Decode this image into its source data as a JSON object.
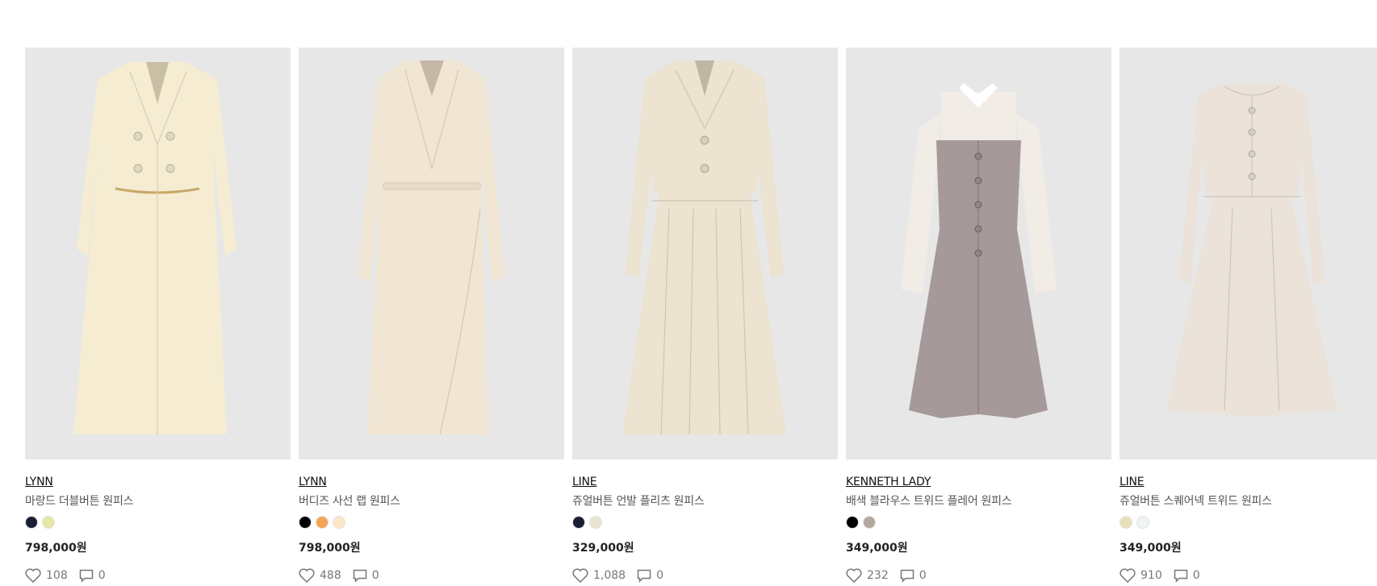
{
  "products": [
    {
      "brand": "LYNN",
      "name": "마랑드 더블버튼 원피스",
      "colors": [
        "#1b1f36",
        "#e6e6a5"
      ],
      "price": "798,000원",
      "likes": "108",
      "comments": "0",
      "garment_color": "#f5ecd2",
      "style": "coat"
    },
    {
      "brand": "LYNN",
      "name": "버디즈 사선 랩 원피스",
      "colors": [
        "#000000",
        "#f7a554",
        "#fce6c8"
      ],
      "price": "798,000원",
      "likes": "488",
      "comments": "0",
      "garment_color": "#f1e6d3",
      "style": "wrap"
    },
    {
      "brand": "LINE",
      "name": "쥬얼버튼 언발 플리츠 원피스",
      "colors": [
        "#1b1f36",
        "#e8e6d2"
      ],
      "price": "329,000원",
      "likes": "1,088",
      "comments": "0",
      "garment_color": "#ece3d0",
      "style": "jacket"
    },
    {
      "brand": "KENNETH LADY",
      "name": "배색 블라우스 트위드 플레어 원피스",
      "colors": [
        "#000000",
        "#b5a89d"
      ],
      "price": "349,000원",
      "likes": "232",
      "comments": "0",
      "garment_color": "#a5999a",
      "style": "tweed-blouse"
    },
    {
      "brand": "LINE",
      "name": "쥬얼버튼 스퀘어넥 트위드 원피스",
      "colors": [
        "#e8e0b8",
        "#eef5f2"
      ],
      "price": "349,000원",
      "likes": "910",
      "comments": "0",
      "garment_color": "#ebe3da",
      "style": "tweed-jacket"
    }
  ]
}
